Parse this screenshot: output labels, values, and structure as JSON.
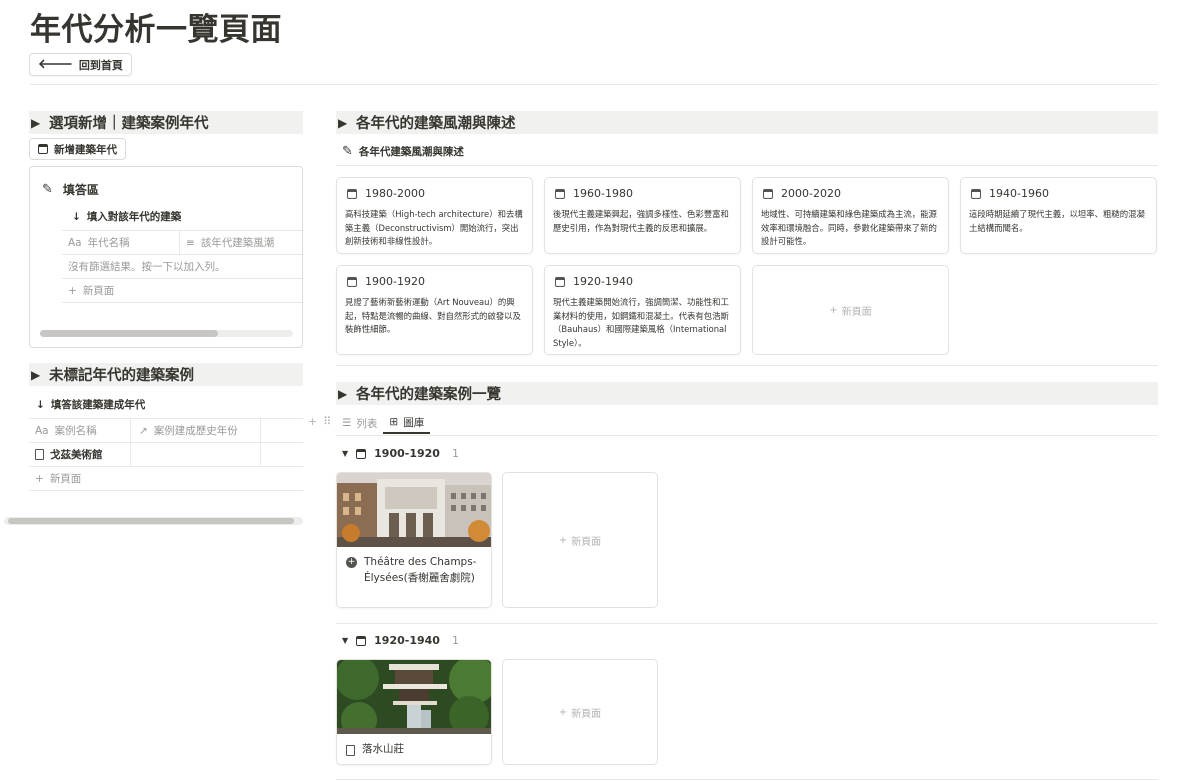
{
  "page": {
    "title": "年代分析一覽頁面",
    "back_button": "回到首頁"
  },
  "left": {
    "section1": {
      "heading": "選項新增｜建築案例年代",
      "new_button": "新增建築年代",
      "form_title": "填答區",
      "form_sub": "填入對該年代的建築",
      "col1": "年代名稱",
      "col2": "該年代建築風潮",
      "empty_text": "沒有篩選結果。按一下以加入列。",
      "new_row": "新頁面",
      "col1_prefix": "Aa"
    },
    "section2": {
      "heading": "未標記年代的建築案例",
      "sub": "填答該建築建成年代",
      "col1_prefix": "Aa",
      "col1": "案例名稱",
      "col2": "案例建成歷史年份",
      "rows": [
        {
          "name": "戈茲美術館"
        }
      ],
      "new_row": "新頁面"
    }
  },
  "right": {
    "era_heading": "各年代的建築風潮與陳述",
    "era_sub": "各年代建築風潮與陳述",
    "era_cards": [
      {
        "title": "1980-2000",
        "desc": "高科技建築（High-tech architecture）和去構築主義（Deconstructivism）開始流行，突出創新技術和非線性設計。"
      },
      {
        "title": "1960-1980",
        "desc": "後現代主義建築興起，強調多樣性、色彩豐富和歷史引用，作為對現代主義的反思和擴展。"
      },
      {
        "title": "2000-2020",
        "desc": "地域性、可持續建築和綠色建築成為主流，能源效率和環境融合。同時，參數化建築帶來了新的設計可能性。"
      },
      {
        "title": "1940-1960",
        "desc": "這段時期延續了現代主義，以坦率、粗糙的混凝土結構而聞名。"
      },
      {
        "title": "1900-1920",
        "desc": "見證了藝術新藝術運動（Art Nouveau）的興起，特點是流暢的曲線、對自然形式的啟發以及裝飾性細節。"
      },
      {
        "title": "1920-1940",
        "desc": " 現代主義建築開始流行，強調簡潔、功能性和工業材料的使用，如鋼鐵和混凝土。代表有包浩斯（Bauhaus）和國際建築風格（International Style）。"
      }
    ],
    "era_new": "新頁面",
    "case_heading": "各年代的建築案例一覽",
    "views": {
      "list": "列表",
      "gallery": "圖庫"
    },
    "groups": [
      {
        "label": "1900-1920",
        "count": "1",
        "card_title": "Théâtre des Champs-Élysées(香榭麗舍劇院)",
        "new": "新頁面"
      },
      {
        "label": "1920-1940",
        "count": "1",
        "card_title": "落水山莊",
        "new": "新頁面"
      }
    ]
  },
  "colors": {
    "accent_bg": "#f1f1ef",
    "text": "#37352f",
    "muted": "#9b9a97",
    "border": "#e9e9e7"
  }
}
